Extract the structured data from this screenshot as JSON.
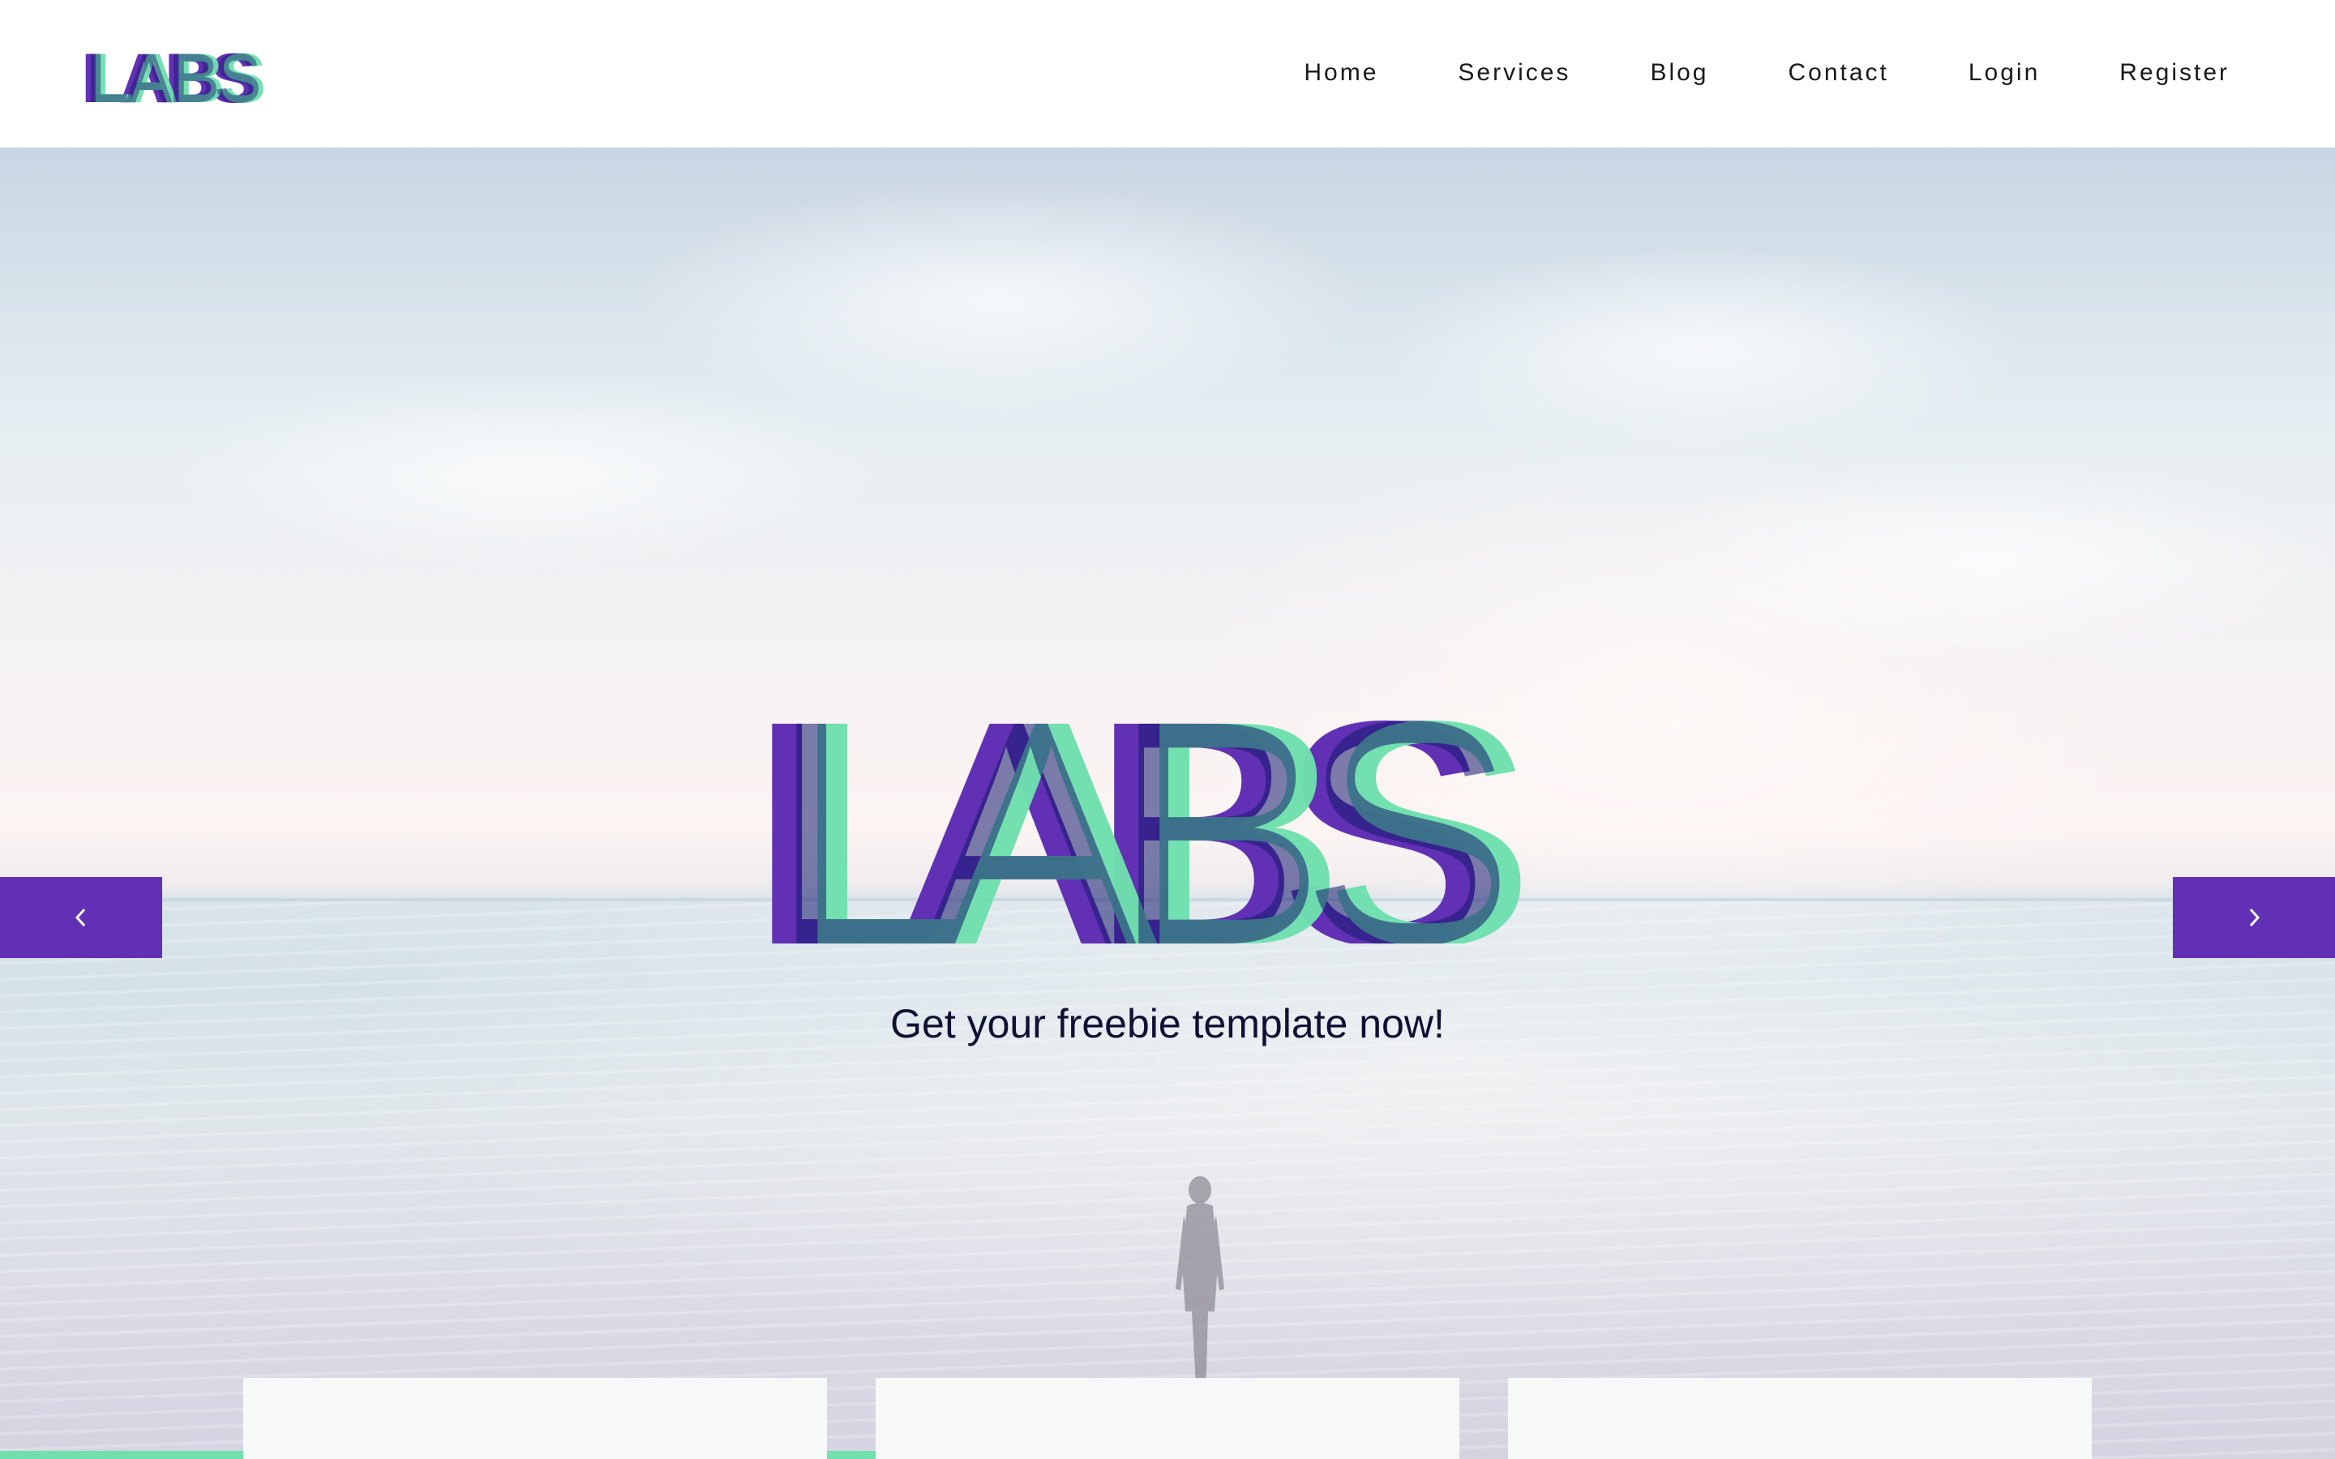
{
  "brand": {
    "logo_text": "LABS",
    "colors": {
      "purple": "#6230b4",
      "green": "#6fe0ae",
      "navy": "#151a6e"
    }
  },
  "nav": {
    "items": [
      {
        "label": "Home"
      },
      {
        "label": "Services"
      },
      {
        "label": "Blog"
      },
      {
        "label": "Contact"
      },
      {
        "label": "Login"
      },
      {
        "label": "Register"
      }
    ]
  },
  "hero": {
    "title": "LABS",
    "subtitle": "Get your freebie template now!",
    "prev_icon": "chevron-left-icon",
    "next_icon": "chevron-right-icon"
  }
}
